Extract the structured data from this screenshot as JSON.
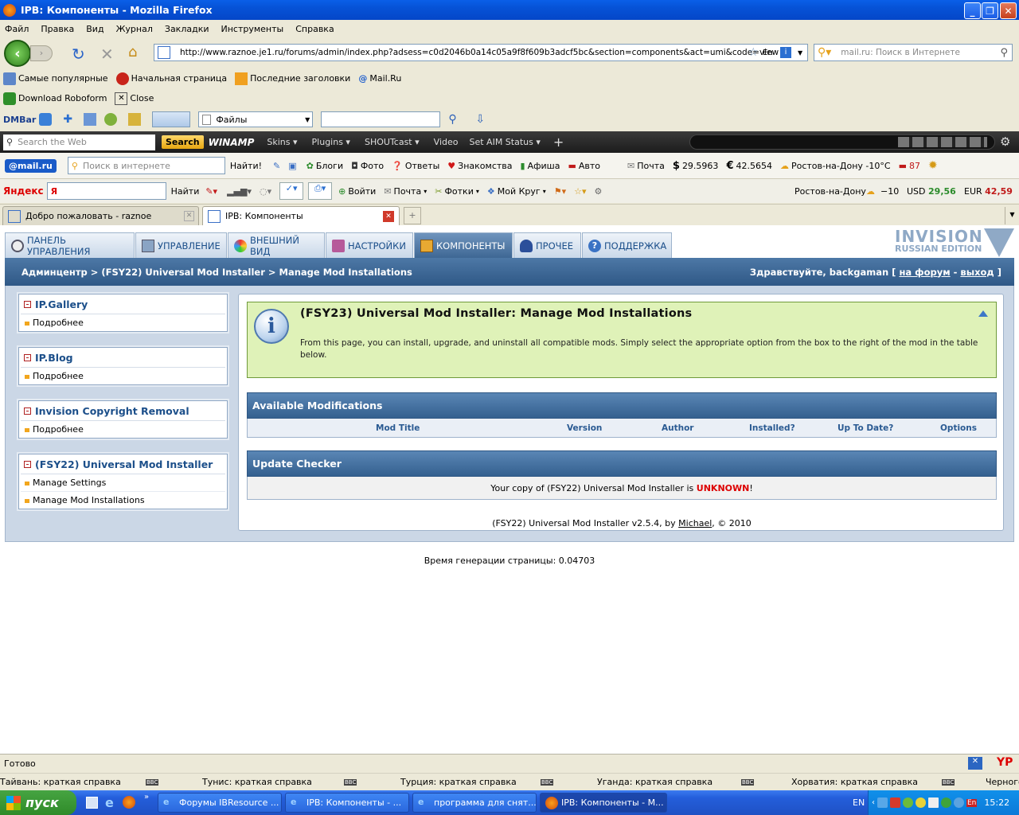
{
  "window": {
    "title": "IPB: Компоненты - Mozilla Firefox"
  },
  "menu": [
    "Файл",
    "Правка",
    "Вид",
    "Журнал",
    "Закладки",
    "Инструменты",
    "Справка"
  ],
  "nav": {
    "url": "http://www.raznoe.je1.ru/forums/admin/index.php?adsess=c0d2046b0a14c05a9f8f609b3adcf5bc&section=components&act=umi&code=view",
    "search_placeholder": "mail.ru: Поиск в Интернете",
    "lang": "En"
  },
  "bookmarks": [
    "Самые популярные",
    "Начальная страница",
    "Последние заголовки",
    "Mail.Ru"
  ],
  "roboform": {
    "download": "Download Roboform",
    "close": "Close"
  },
  "dmbar": {
    "label": "DMBar",
    "select": "Файлы"
  },
  "winamp": {
    "search_placeholder": "Search the Web",
    "search_btn": "Search",
    "logo": "WINAMP",
    "items": [
      "Skins",
      "Plugins",
      "SHOUTcast",
      "Video",
      "Set AIM Status"
    ]
  },
  "mailru": {
    "logo": "@mail.ru",
    "search_placeholder": "Поиск в интернете",
    "find": "Найти!",
    "links": [
      "Блоги",
      "Фото",
      "Ответы",
      "Знакомства",
      "Афиша",
      "Авто"
    ],
    "mail": "Почта",
    "usd": "29.5963",
    "eur": "42.5654",
    "weather": "Ростов-на-Дону -10°C",
    "count": "87"
  },
  "yandex": {
    "logo": "Яндекс",
    "find": "Найти",
    "items": [
      "Войти",
      "Почта",
      "Фотки",
      "Мой Круг"
    ],
    "city": "Ростов-на-Дону",
    "temp": "−10",
    "usd_label": "USD",
    "usd": "29,56",
    "eur_label": "EUR",
    "eur": "42,59"
  },
  "tabs": [
    {
      "label": "Добро пожаловать - raznoe"
    },
    {
      "label": "IPB: Компоненты"
    }
  ],
  "acp": {
    "tabs": [
      "ПАНЕЛЬ УПРАВЛЕНИЯ",
      "УПРАВЛЕНИЕ",
      "ВНЕШНИЙ ВИД",
      "НАСТРОЙКИ",
      "КОМПОНЕНТЫ",
      "ПРОЧЕЕ",
      "ПОДДЕРЖКА"
    ],
    "logo_top": "INVISION",
    "logo_bottom": "RUSSIAN EDITION",
    "breadcrumb": "Админцентр > (FSY22) Universal Mod Installer > Manage Mod Installations",
    "greeting": "Здравствуйте, backgaman [",
    "forum_link": "на форум",
    "dash": "-",
    "logout_link": "выход",
    "close_bracket": "]"
  },
  "sidebar": [
    {
      "title": "IP.Gallery",
      "items": [
        "Подробнее"
      ]
    },
    {
      "title": "IP.Blog",
      "items": [
        "Подробнее"
      ]
    },
    {
      "title": "Invision Copyright Removal",
      "items": [
        "Подробнее"
      ]
    },
    {
      "title": "(FSY22) Universal Mod Installer",
      "items": [
        "Manage Settings",
        "Manage Mod Installations"
      ]
    }
  ],
  "info": {
    "title": "(FSY23) Universal Mod Installer: Manage Mod Installations",
    "text": "From this page, you can install, upgrade, and uninstall all compatible mods. Simply select the appropriate option from the box to the right of the mod in the table below."
  },
  "mods": {
    "header": "Available Modifications",
    "columns": [
      "Mod Title",
      "Version",
      "Author",
      "Installed?",
      "Up To Date?",
      "Options"
    ]
  },
  "updates": {
    "header": "Update Checker",
    "text_before": "Your copy of (FSY22) Universal Mod Installer is ",
    "status": "UNKNOWN",
    "text_after": "!"
  },
  "footer": {
    "before": "(FSY22) Universal Mod Installer v2.5.4, by ",
    "author": "Michael",
    "after": ", © 2010"
  },
  "gentime": "Время генерации страницы: 0.04703",
  "status": {
    "text": "Готово",
    "yp": "YP"
  },
  "news": [
    "Тайвань: краткая справка",
    "Тунис: краткая справка",
    "Турция: краткая справка",
    "Уганда: краткая справка",
    "Хорватия: краткая справка",
    "Черного"
  ],
  "taskbar": {
    "start": "пуск",
    "tasks": [
      "Форумы IBResource ...",
      "IPB: Компоненты - ...",
      "программа для снят...",
      "IPB: Компоненты - M..."
    ],
    "lang": "EN",
    "clock": "15:22"
  },
  "colors": {
    "acp_blue": "#34608f",
    "info_green": "#dff2b8",
    "unknown_red": "#dd0000"
  }
}
